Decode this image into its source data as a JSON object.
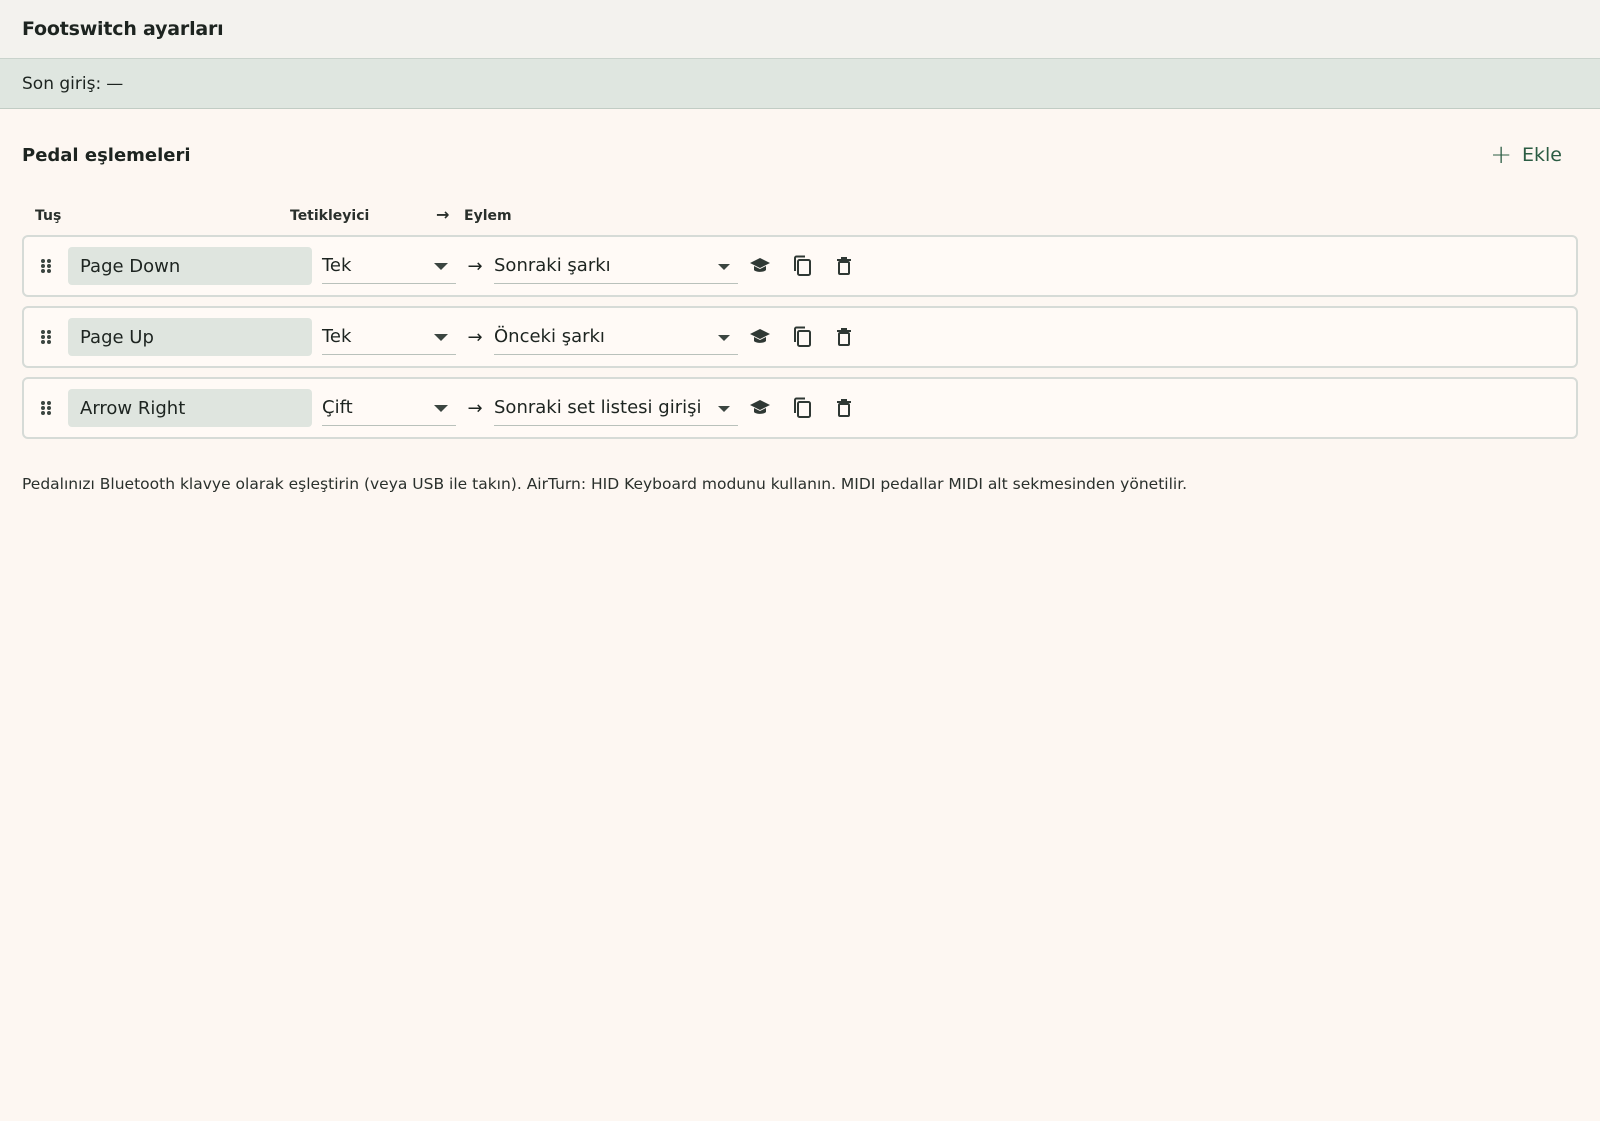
{
  "header": {
    "title": "Footswitch ayarları"
  },
  "status": {
    "label": "Son giriş:",
    "value": "—"
  },
  "section": {
    "title": "Pedal eşlemeleri",
    "add_label": "Ekle"
  },
  "columns": {
    "key": "Tuş",
    "trigger": "Tetikleyici",
    "action": "Eylem"
  },
  "rows": [
    {
      "key": "Page Down",
      "trigger": "Tek",
      "action": "Sonraki şarkı"
    },
    {
      "key": "Page Up",
      "trigger": "Tek",
      "action": "Önceki şarkı"
    },
    {
      "key": "Arrow Right",
      "trigger": "Çift",
      "action": "Sonraki set listesi girişi"
    }
  ],
  "note": "Pedalınızı Bluetooth klavye olarak eşleştirin (veya USB ile takın). AirTurn: HID Keyboard modunu kullanın. MIDI pedallar MIDI alt sekmesinden yönetilir.",
  "icons": [
    "drag-handle-icon",
    "arrow-right-icon",
    "learn-icon",
    "copy-icon",
    "delete-icon",
    "plus-icon"
  ],
  "colors": {
    "accent": "#2b5c43",
    "background": "#fdf7f2",
    "field": "#dfe5df",
    "status_bar": "#dfe6e0"
  }
}
